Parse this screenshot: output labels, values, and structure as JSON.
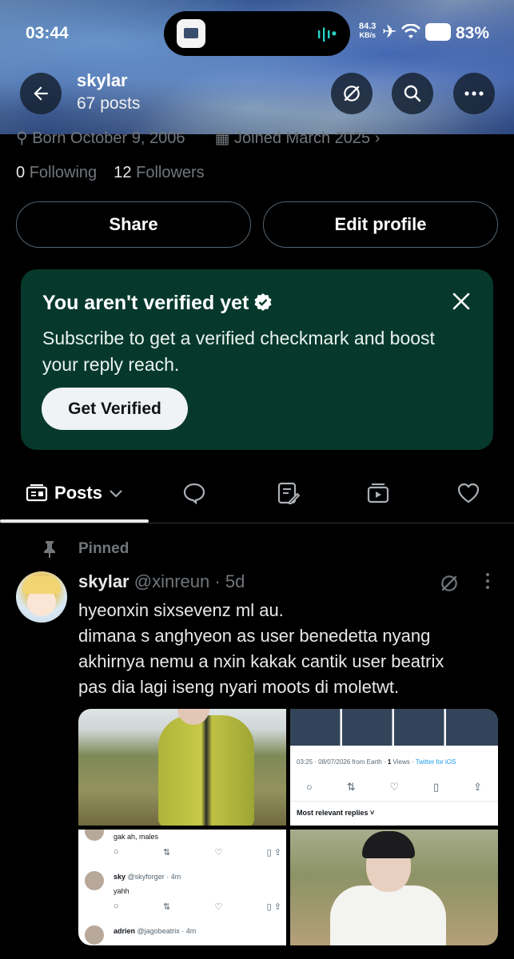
{
  "status_bar": {
    "time": "03:44",
    "net_speed": "84.3",
    "net_unit": "KB/s",
    "battery": "83%"
  },
  "header": {
    "name": "skylar",
    "post_count": "67 posts"
  },
  "profile": {
    "born": "Born October 9, 2006",
    "joined": "Joined March 2025",
    "following_count": "0",
    "following_label": "Following",
    "followers_count": "12",
    "followers_label": "Followers",
    "share_label": "Share",
    "edit_label": "Edit profile"
  },
  "verify_card": {
    "title": "You aren't verified yet",
    "body": "Subscribe to get a verified checkmark and boost your reply reach.",
    "cta": "Get Verified",
    "background": "#06392b"
  },
  "tabs": {
    "active_label": "Posts",
    "items": [
      "posts",
      "replies",
      "articles",
      "media",
      "likes"
    ]
  },
  "post": {
    "pinned_label": "Pinned",
    "name": "skylar",
    "handle": "@xinreun",
    "age": "5d",
    "text_lines": [
      "hyeonxin sixsevenz ml au.",
      "dimana s anghyeon as user benedetta nyang",
      "akhirnya nemu a nxin kakak cantik user beatrix",
      "pas dia lagi iseng nyari moots di moletwt."
    ],
    "media": {
      "screenshot_meta": "03:25 · 08/07/2026 from Earth · ",
      "screenshot_views": "1",
      "screenshot_views_label": " Views · ",
      "screenshot_client": "Twitter for iOS",
      "screenshot_relevant": "Most relevant replies",
      "reply1_text": "gak ah, males",
      "reply2_name": "sky",
      "reply2_handle": "@skyforger · 4m",
      "reply2_text": "yahh",
      "reply3_name": "adrien",
      "reply3_handle": "@jagobeatrix · 4m"
    }
  },
  "colors": {
    "background": "#000000",
    "muted_text": "#71767b",
    "accent_blue": "#1d9bf0"
  }
}
